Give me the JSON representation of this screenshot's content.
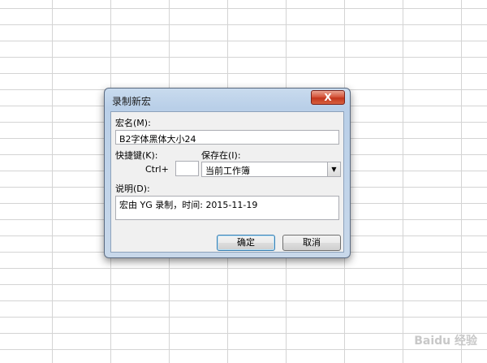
{
  "dialog": {
    "title": "录制新宏",
    "close_glyph": "X",
    "macro_name": {
      "label": "宏名(M):",
      "value": "B2字体黑体大小24"
    },
    "shortcut": {
      "label": "快捷键(K):",
      "prefix": "Ctrl+",
      "value": ""
    },
    "store_in": {
      "label": "保存在(I):",
      "selected": "当前工作簿",
      "arrow_glyph": "▼"
    },
    "description": {
      "label": "说明(D):",
      "value": "宏由 YG 录制，时间: 2015-11-19"
    },
    "ok_label": "确定",
    "cancel_label": "取消"
  },
  "watermark": "Baidu 经验"
}
